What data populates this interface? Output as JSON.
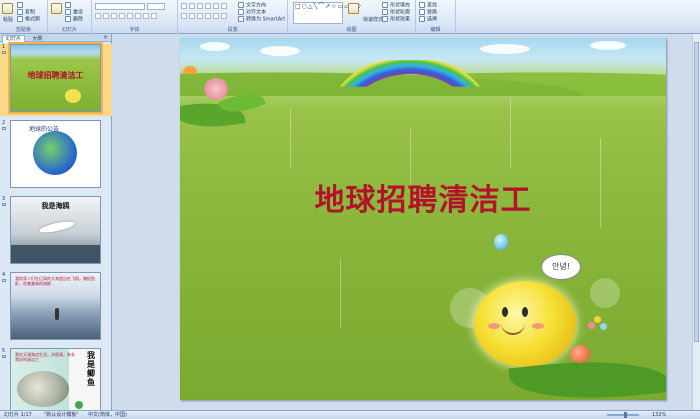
{
  "ribbon": {
    "groups": {
      "clipboard": "剪贴板",
      "slides": "幻灯片",
      "font": "字体",
      "paragraph": "段落",
      "drawing": "绘图",
      "editing": "编辑"
    },
    "buttons": {
      "paste": "粘贴",
      "copy": "复制",
      "format_painter": "格式刷",
      "new_slide": "新建\n幻灯片",
      "reset": "重设",
      "delete": "删除",
      "text_direction": "文字方向",
      "align_text": "对齐文本",
      "convert_smartart": "转换为 SmartArt",
      "quick_styles": "快速样式",
      "shape_fill": "形状填充",
      "shape_outline": "形状轮廓",
      "shape_effects": "形状效果",
      "find": "查找",
      "replace": "替换",
      "select": "选择"
    }
  },
  "panel": {
    "tab_slides": "幻灯片",
    "tab_outline": "大纲",
    "close": "×"
  },
  "thumbnails": [
    {
      "num": "1",
      "caption": "地球招聘清洁工"
    },
    {
      "num": "2",
      "caption": "地球的公告"
    },
    {
      "num": "3",
      "caption": "我是海鸥"
    },
    {
      "num": "4",
      "caption": "我的家人们在辽阔的大海里自在飞翔，捕捉鱼虾，吃着美味的海鲜"
    },
    {
      "num": "5",
      "caption": "我在天津海边生活，水很清，有非常好的清洁工",
      "side": "我是鲫鱼"
    }
  ],
  "slide": {
    "title": "地球招聘清洁工",
    "speech": "안녕!"
  },
  "status": {
    "slide_info": "幻灯片 1/17",
    "theme": "\"默认设计模板\"",
    "language": "中文(简体，中国)",
    "zoom": "132%"
  },
  "colors": {
    "title_red": "#b4122a",
    "ribbon_bg": "#dbe7f6",
    "selection": "#f0b548"
  }
}
